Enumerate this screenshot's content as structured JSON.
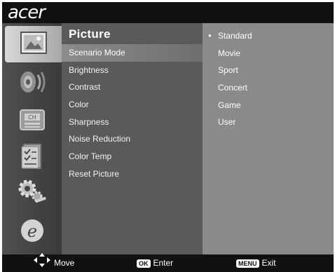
{
  "brand": {
    "logo": "acer"
  },
  "sidebar": {
    "icons": [
      {
        "name": "picture-icon",
        "selected": true
      },
      {
        "name": "audio-icon",
        "selected": false
      },
      {
        "name": "channel-icon",
        "selected": false
      },
      {
        "name": "settings-list-icon",
        "selected": false
      },
      {
        "name": "setup-gears-icon",
        "selected": false
      },
      {
        "name": "acer-e-icon",
        "selected": false
      }
    ]
  },
  "menu": {
    "title": "Picture",
    "items": [
      {
        "label": "Scenario Mode",
        "selected": true
      },
      {
        "label": "Brightness"
      },
      {
        "label": "Contrast"
      },
      {
        "label": "Color"
      },
      {
        "label": "Sharpness"
      },
      {
        "label": "Noise Reduction"
      },
      {
        "label": "Color Temp"
      },
      {
        "label": "Reset Picture"
      }
    ]
  },
  "options": {
    "current": "Standard",
    "items": [
      {
        "label": "Standard",
        "selected": true
      },
      {
        "label": "Movie"
      },
      {
        "label": "Sport"
      },
      {
        "label": "Concert"
      },
      {
        "label": "Game"
      },
      {
        "label": "User"
      }
    ]
  },
  "hints": {
    "move_label": "Move",
    "ok_key": "OK",
    "enter_label": "Enter",
    "menu_key": "MENU",
    "exit_label": "Exit"
  },
  "colors": {
    "brand_bar": "#111111",
    "menu_bg": "#5a5a5a",
    "options_bg": "#8a8a8a"
  }
}
